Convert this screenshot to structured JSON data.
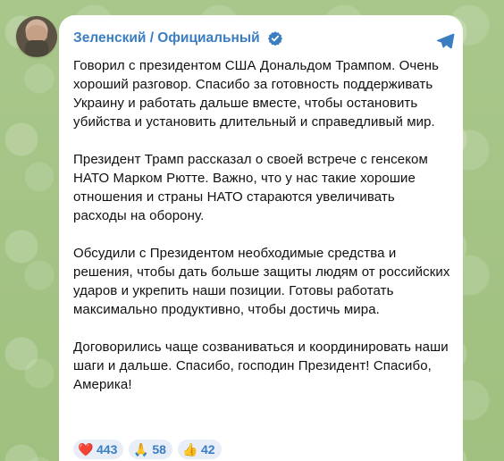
{
  "header": {
    "channel_name": "Зеленский / Официальный"
  },
  "message": {
    "paragraphs": [
      "Говорил с президентом США Дональдом Трампом. Очень хороший разговор. Спасибо за готовность поддерживать Украину и работать дальше вместе, чтобы остановить убийства и установить длительный и справедливый мир.",
      "Президент Трамп рассказал о своей встрече с генсеком НАТО Марком Рютте. Важно, что у нас такие хорошие отношения и страны НАТО стараются увеличивать расходы на оборону.",
      "Обсудили с Президентом необходимые средства и решения, чтобы дать больше защиты людям от российских ударов и укрепить наши позиции. Готовы работать максимально продуктивно, чтобы достичь мира.",
      "Договорились чаще созваниваться и координировать наши шаги и дальше. Спасибо, господин Президент! Спасибо, Америка!"
    ]
  },
  "reactions": [
    {
      "emoji": "❤️",
      "count": "443"
    },
    {
      "emoji": "🙏",
      "count": "58"
    },
    {
      "emoji": "👍",
      "count": "42"
    }
  ],
  "icons": {
    "avatar": "profile-avatar",
    "verified": "verified-badge-icon",
    "share": "share-icon"
  },
  "colors": {
    "accent": "#3a7ec1",
    "reaction_bg": "#e7eef8",
    "background": "#a8c48a",
    "card": "#ffffff",
    "text": "#101010"
  }
}
